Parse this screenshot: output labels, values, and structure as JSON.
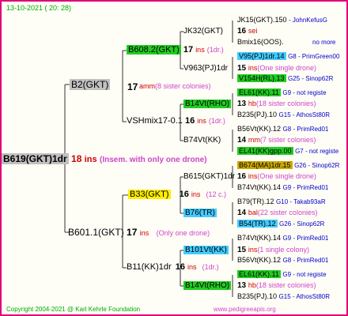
{
  "header": {
    "date": "13-10-2021 ( 20: 28)"
  },
  "footer": {
    "copyright": "Copyright 2004-2021 @ Karl Kehrle Foundation",
    "url": "www.pedigreeapis.org"
  },
  "root": {
    "name": "B619(GKT)1dr",
    "gen": "18",
    "suffix": "ins",
    "note": "(Insem. with only one drone)"
  },
  "g1": {
    "top": {
      "name": "B2(GKT)",
      "gen": "17",
      "suffix": "amm",
      "note": "(8 sister colonies)"
    },
    "bottom": {
      "name": "B601.1(GKT)",
      "gen": "17",
      "suffix": "ins",
      "note": "(Only one drone)"
    }
  },
  "g2": {
    "a": {
      "name": "B608.2(GKT)",
      "gen": "17",
      "suffix": "ins",
      "note": "(1dr.)"
    },
    "b": {
      "name": "VSHmix17-0.1",
      "gen": "16",
      "suffix": "ins",
      "note": "(1dr.)"
    },
    "c": {
      "name": "B33(GKT)",
      "gen": "16",
      "suffix": "ins",
      "note": "(12 c.)"
    },
    "d": {
      "name": "B11(KK)1dr",
      "gen": "16",
      "suffix": "ins",
      "note": "(1dr.)"
    }
  },
  "g3": {
    "a": {
      "name": "JK32(GKT)",
      "gen": "16",
      "suffix": "sei"
    },
    "b": {
      "name": "V963(PJ)1dr",
      "gen": "15",
      "suffix": "ins",
      "note": "(One single drone)"
    },
    "c": {
      "name": "B14Vt(RHO)",
      "gen": "13",
      "suffix": "hb",
      "note": "(18 sister colonies)"
    },
    "d": {
      "name": "B74Vt(KK)",
      "gen": "14",
      "suffix": "mm",
      "note": "(7 sister colonies)"
    },
    "e": {
      "name": "B615(GKT)1dr",
      "gen": "16",
      "suffix": "ins",
      "note": "(One single drone)"
    },
    "f": {
      "name": "B76(TR)",
      "gen": "14",
      "suffix": "bal",
      "note": "(22 sister colonies)"
    },
    "g": {
      "name": "B101Vt(KK)",
      "gen": "15",
      "suffix": "ins",
      "note": "(1 single colony)"
    },
    "h": {
      "name": "B14Vt(RHO)",
      "gen": "13",
      "suffix": "hb",
      "note": "(18 sister colonies)"
    }
  },
  "g4": [
    {
      "name": "JK15(GKT).150",
      "right": "- JohnKefusG"
    },
    {
      "name": "Bmix16(OOS).",
      "right": "no more"
    },
    {
      "name": "V95(PJ)1dr.14",
      "right": "G8 - PrimGreen00"
    },
    {
      "name": "V154H(RL).13",
      "right": "G25 - Sinop62R"
    },
    {
      "name": "EL61(KK).11",
      "right": "G9 - not registe"
    },
    {
      "name": "B235(PJ).10",
      "right": "G15 - AthosSt80R"
    },
    {
      "name": "B56Vt(KK).12",
      "right": "G8 - PrimRed01"
    },
    {
      "name": "EL41(KK)gpp.00",
      "right": "G7 - not registe"
    },
    {
      "name": "B674(MA)1dr.15",
      "right": "G26 - Sinop62R"
    },
    {
      "name": "B74Vt(KK).14",
      "right": "G9 - PrimRed01"
    },
    {
      "name": "B79(TR).12",
      "right": "G10 - Takab93aR"
    },
    {
      "name": "B54(TR).12",
      "right": "G26 - Sinop62R"
    },
    {
      "name": "B74Vt(KK).14",
      "right": "G9 - PrimRed01"
    },
    {
      "name": "B56Vt(KK).12",
      "right": "G8 - PrimRed01"
    },
    {
      "name": "EL61(KK).11",
      "right": "G9 - not registe"
    },
    {
      "name": "B235(PJ).10",
      "right": "G15 - AthosSt80R"
    }
  ]
}
